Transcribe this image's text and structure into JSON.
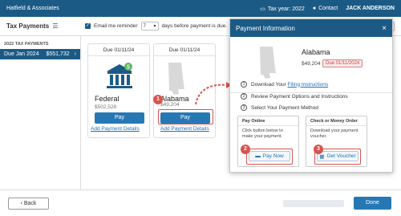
{
  "topbar": {
    "firm": "Hatfield & Associates",
    "tax_year": "Tax year: 2022",
    "contact": "Contact",
    "user": "JACK ANDERSON"
  },
  "subbar": {
    "title": "Tax Payments",
    "reminder_before": "Email me reminder",
    "reminder_days": "7",
    "reminder_after": "days before payment is due."
  },
  "sidebar": {
    "header": "2022 TAX PAYMENTS",
    "items": [
      {
        "label": "Due Jan 2024",
        "amount": "$551,732"
      }
    ]
  },
  "cards": [
    {
      "due": "Due 01/11/24",
      "name": "Federal",
      "amount": "$502,528",
      "pay": "Pay",
      "details": "Add Payment Details"
    },
    {
      "due": "Due 01/11/24",
      "name": "Alabama",
      "amount": "$49,204",
      "pay": "Pay",
      "details": "Add Payment Details"
    }
  ],
  "modal": {
    "title": "Payment Information",
    "state": "Alabama",
    "amount": "$49,204",
    "due_badge": "Due 01/11/2024",
    "steps": [
      {
        "num": "1",
        "text": "Download Your ",
        "link": "Filing Instructions"
      },
      {
        "num": "2",
        "text": "Review Payment Options and Instructions"
      },
      {
        "num": "3",
        "text": "Select Your Payment Method"
      }
    ],
    "online": {
      "title": "Pay Online",
      "desc": "Click button below to make your payment.",
      "button": "Pay Now"
    },
    "check": {
      "title": "Check or Money Order",
      "desc": "Download your payment voucher.",
      "button": "Get Voucher"
    }
  },
  "callouts": [
    "1",
    "2",
    "3"
  ],
  "bottom": {
    "back": "Back",
    "done": "Done"
  },
  "colors": {
    "brand": "#1c5a86",
    "button": "#2678b5",
    "callout": "#d9534f"
  }
}
